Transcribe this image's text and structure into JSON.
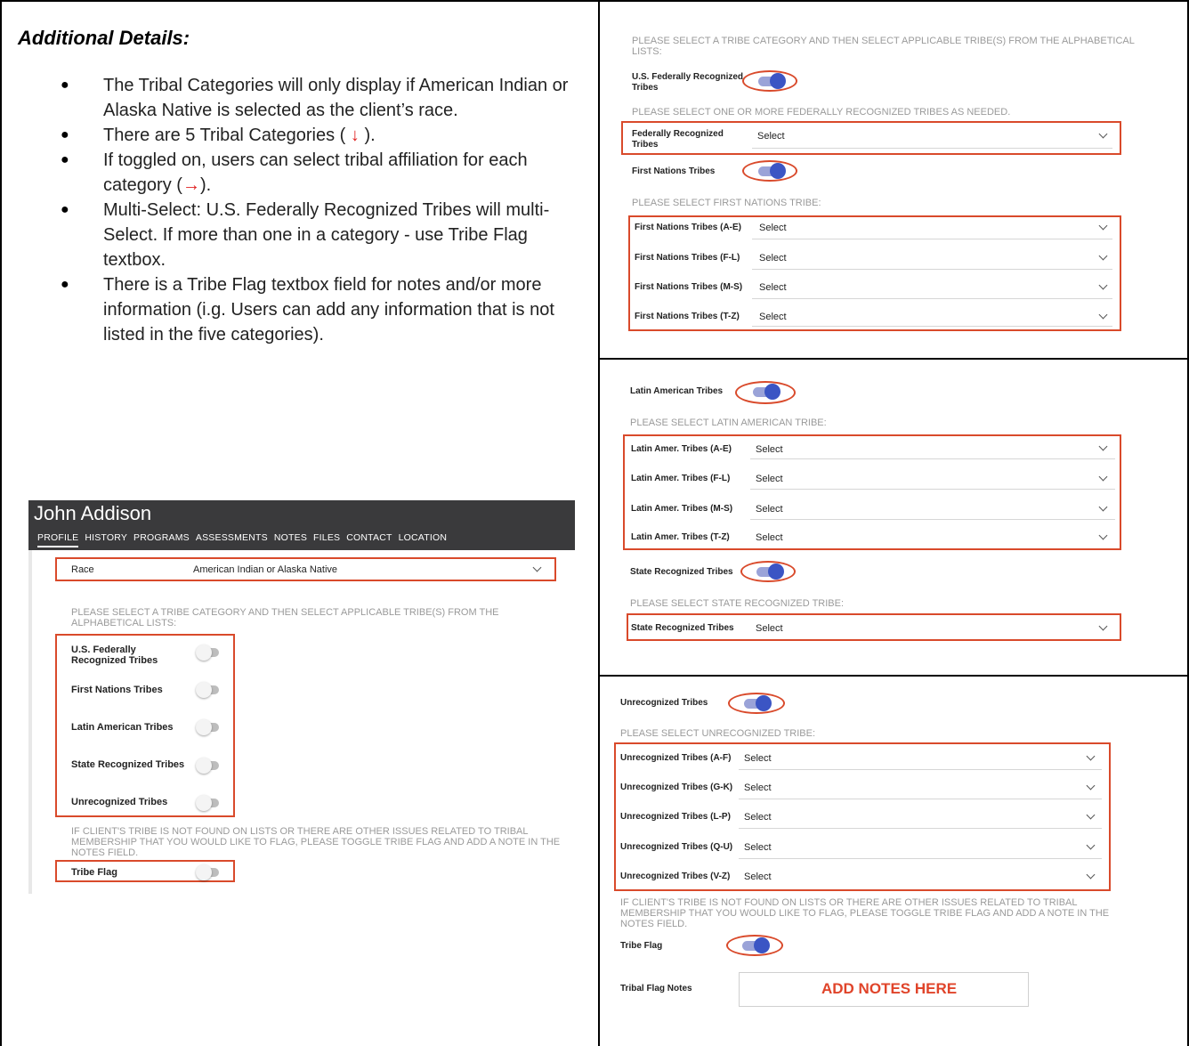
{
  "left": {
    "title": "Additional Details:",
    "bullets": [
      {
        "text": "The Tribal Categories will only display if American Indian or Alaska Native is selected as the client’s race."
      },
      {
        "pre": "There are 5 Tribal Categories ( ",
        "arrow": "↓",
        "post": " )."
      },
      {
        "pre": "If toggled on, users can select tribal affiliation for each category (",
        "arrow": "→",
        "post": ")."
      },
      {
        "text": "Multi-Select: U.S. Federally Recognized Tribes will multi-Select. If more than one in a category - use Tribe Flag textbox."
      },
      {
        "text": "There is a Tribe Flag textbox field for notes and/or more information (i.g. Users can add any information that is not listed in the five categories)."
      }
    ]
  },
  "app": {
    "client_name": "John Addison",
    "tabs": [
      "PROFILE",
      "HISTORY",
      "PROGRAMS",
      "ASSESSMENTS",
      "NOTES",
      "FILES",
      "CONTACT",
      "LOCATION"
    ],
    "race_label": "Race",
    "race_value": "American Indian or Alaska Native",
    "instruction": "PLEASE SELECT A TRIBE CATEGORY AND THEN SELECT APPLICABLE TRIBE(S) FROM THE ALPHABETICAL LISTS:",
    "categories": [
      "U.S. Federally Recognized Tribes",
      "First Nations Tribes",
      "Latin American Tribes",
      "State Recognized Tribes",
      "Unrecognized Tribes"
    ],
    "flag_instruction": "IF CLIENT'S TRIBE IS NOT FOUND ON LISTS OR THERE ARE OTHER ISSUES RELATED TO TRIBAL MEMBERSHIP THAT YOU WOULD LIKE TO FLAG, PLEASE TOGGLE TRIBE FLAG AND ADD A NOTE IN THE NOTES FIELD.",
    "tribe_flag_label": "Tribe Flag",
    "select_placeholder": "Select"
  },
  "panel1": {
    "instruction": "PLEASE SELECT A TRIBE CATEGORY AND THEN SELECT APPLICABLE TRIBE(S) FROM THE ALPHABETICAL LISTS:",
    "federal_toggle": "U.S. Federally Recognized Tribes",
    "federal_hint": "PLEASE SELECT ONE OR MORE FEDERALLY RECOGNIZED TRIBES AS NEEDED.",
    "federal_select": "Federally Recognized Tribes",
    "first_toggle": "First Nations Tribes",
    "first_hint": "PLEASE SELECT FIRST NATIONS TRIBE:",
    "first_selects": [
      "First Nations Tribes (A-E)",
      "First Nations Tribes (F-L)",
      "First Nations Tribes (M-S)",
      "First Nations Tribes (T-Z)"
    ]
  },
  "panel2": {
    "latin_toggle": "Latin American Tribes",
    "latin_hint": "PLEASE SELECT LATIN AMERICAN TRIBE:",
    "latin_selects": [
      "Latin Amer. Tribes (A-E)",
      "Latin Amer. Tribes (F-L)",
      "Latin Amer. Tribes (M-S)",
      "Latin Amer. Tribes (T-Z)"
    ],
    "state_toggle": "State Recognized Tribes",
    "state_hint": "PLEASE SELECT STATE RECOGNIZED TRIBE:",
    "state_select": "State Recognized Tribes"
  },
  "panel3": {
    "unrec_toggle": "Unrecognized Tribes",
    "unrec_hint": "PLEASE SELECT UNRECOGNIZED TRIBE:",
    "unrec_selects": [
      "Unrecognized Tribes (A-F)",
      "Unrecognized Tribes (G-K)",
      "Unrecognized Tribes (L-P)",
      "Unrecognized Tribes (Q-U)",
      "Unrecognized Tribes (V-Z)"
    ],
    "flag_instruction": "IF CLIENT'S TRIBE IS NOT FOUND ON LISTS OR THERE ARE OTHER ISSUES RELATED TO TRIBAL MEMBERSHIP THAT YOU WOULD LIKE TO FLAG, PLEASE TOGGLE TRIBE FLAG AND ADD A NOTE IN THE NOTES FIELD.",
    "flag_label": "Tribe Flag",
    "notes_label": "Tribal Flag Notes",
    "notes_text": "ADD NOTES HERE"
  },
  "colors": {
    "highlight": "#d94a2b",
    "toggle_on": "#3b55c4",
    "arrow": "#e02020"
  }
}
